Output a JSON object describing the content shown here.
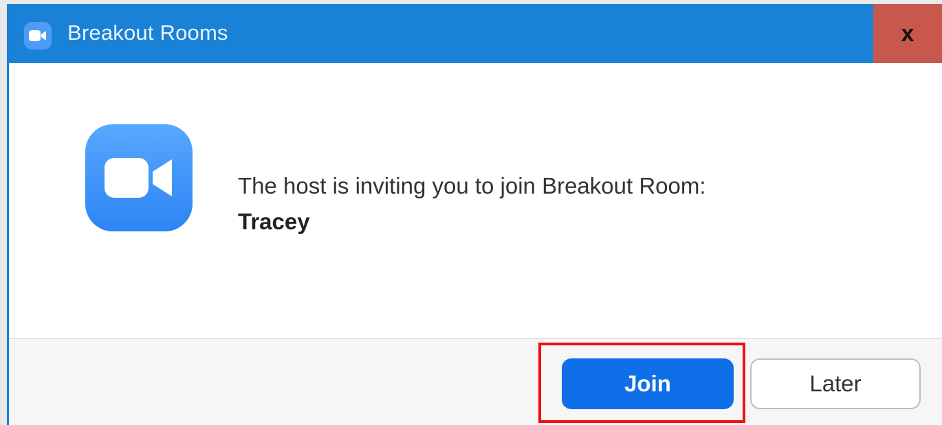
{
  "window": {
    "title": "Breakout Rooms",
    "close_label": "x"
  },
  "message": {
    "text": "The host is inviting you to join Breakout Room:",
    "room_name": "Tracey"
  },
  "buttons": {
    "join_label": "Join",
    "later_label": "Later"
  },
  "colors": {
    "titlebar": "#1a82d6",
    "close_button": "#c8584d",
    "join_button": "#0e6fe8",
    "highlight": "#ee1111"
  }
}
